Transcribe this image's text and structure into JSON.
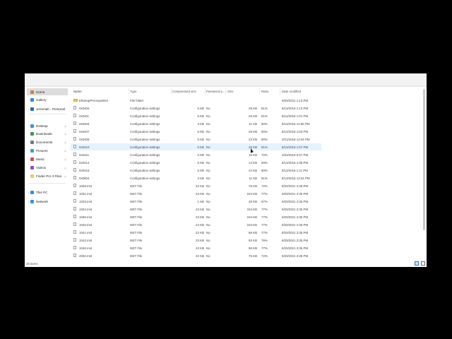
{
  "sidebar": {
    "items": [
      {
        "label": "Home",
        "icon": "home-icon",
        "color": "#e07b39"
      },
      {
        "label": "Gallery",
        "icon": "gallery-icon",
        "color": "#2f8ae0"
      },
      {
        "label": "Jeremiah - Personal",
        "icon": "cloud-icon",
        "color": "#1f6fc4"
      },
      {
        "label": "Desktop",
        "icon": "desktop-icon",
        "color": "#3a8ee6"
      },
      {
        "label": "Downloads",
        "icon": "download-icon",
        "color": "#3a9a4a"
      },
      {
        "label": "Documents",
        "icon": "documents-icon",
        "color": "#6b7b8c"
      },
      {
        "label": "Pictures",
        "icon": "pictures-icon",
        "color": "#3aa0d8"
      },
      {
        "label": "Music",
        "icon": "music-icon",
        "color": "#e0445b"
      },
      {
        "label": "Videos",
        "icon": "videos-icon",
        "color": "#8a4bd6"
      },
      {
        "label": "Finder Pro 3 Files",
        "icon": "folder-icon",
        "color": "#f0c75e"
      },
      {
        "label": "This PC",
        "icon": "pc-icon",
        "color": "#3a8ee6"
      },
      {
        "label": "Network",
        "icon": "network-icon",
        "color": "#3a8ee6"
      }
    ]
  },
  "columns": {
    "name": "Name",
    "type": "Type",
    "compressed": "Compressed size",
    "password": "Password p...",
    "size": "Size",
    "ratio": "Ratio",
    "date": "Date modified"
  },
  "files": [
    {
      "name": "ElSetupPrerequisites",
      "type": "File folder",
      "compressed": "",
      "password": "",
      "size": "",
      "ratio": "",
      "date": "9/20/2021 1:13 PM",
      "folder": true
    },
    {
      "name": "0x040a",
      "type": "Configuration settings",
      "compressed": "5 KB",
      "password": "No",
      "size": "25 KB",
      "ratio": "81%",
      "date": "8/12/2016 1:13 PM"
    },
    {
      "name": "0x040c",
      "type": "Configuration settings",
      "compressed": "5 KB",
      "password": "No",
      "size": "26 KB",
      "ratio": "81%",
      "date": "8/12/2016 1:01 PM"
    },
    {
      "name": "0x0404",
      "type": "Configuration settings",
      "compressed": "3 KB",
      "password": "No",
      "size": "11 KB",
      "ratio": "80%",
      "date": "8/12/2016 12:56 PM"
    },
    {
      "name": "0x0407",
      "type": "Configuration settings",
      "compressed": "6 KB",
      "password": "No",
      "size": "26 KB",
      "ratio": "80%",
      "date": "8/12/2016 1:03 PM"
    },
    {
      "name": "0x0409",
      "type": "Configuration settings",
      "compressed": "5 KB",
      "password": "No",
      "size": "22 KB",
      "ratio": "80%",
      "date": "3/21/2016 12:04 PM"
    },
    {
      "name": "0x0410",
      "type": "Configuration settings",
      "compressed": "5 KB",
      "password": "No",
      "size": "25 KB",
      "ratio": "81%",
      "date": "8/12/2016 1:07 PM"
    },
    {
      "name": "0x0411",
      "type": "Configuration settings",
      "compressed": "5 KB",
      "password": "No",
      "size": "15 KB",
      "ratio": "70%",
      "date": "3/22/2016 5:57 PM"
    },
    {
      "name": "0x0412",
      "type": "Configuration settings",
      "compressed": "5 KB",
      "password": "No",
      "size": "14 KB",
      "ratio": "65%",
      "date": "8/12/2016 1:08 PM"
    },
    {
      "name": "0x0416",
      "type": "Configuration settings",
      "compressed": "5 KB",
      "password": "No",
      "size": "24 KB",
      "ratio": "80%",
      "date": "8/12/2016 1:11 PM"
    },
    {
      "name": "0x0804",
      "type": "Configuration settings",
      "compressed": "3 KB",
      "password": "No",
      "size": "11 KB",
      "ratio": "81%",
      "date": "8/12/2016 12:54 PM"
    },
    {
      "name": "1028.mst",
      "type": "MST File",
      "compressed": "22 KB",
      "password": "No",
      "size": "76 KB",
      "ratio": "72%",
      "date": "9/20/2021 2:35 PM"
    },
    {
      "name": "1031.mst",
      "type": "MST File",
      "compressed": "23 KB",
      "password": "No",
      "size": "104 KB",
      "ratio": "77%",
      "date": "9/20/2021 2:35 PM"
    },
    {
      "name": "1033.mst",
      "type": "MST File",
      "compressed": "1 KB",
      "password": "No",
      "size": "20 KB",
      "ratio": "97%",
      "date": "9/20/2021 2:35 PM"
    },
    {
      "name": "1034.mst",
      "type": "MST File",
      "compressed": "23 KB",
      "password": "No",
      "size": "104 KB",
      "ratio": "77%",
      "date": "9/20/2021 2:35 PM"
    },
    {
      "name": "1036.mst",
      "type": "MST File",
      "compressed": "23 KB",
      "password": "No",
      "size": "104 KB",
      "ratio": "77%",
      "date": "9/20/2021 2:35 PM"
    },
    {
      "name": "1040.mst",
      "type": "MST File",
      "compressed": "24 KB",
      "password": "No",
      "size": "104 KB",
      "ratio": "77%",
      "date": "9/20/2021 2:35 PM"
    },
    {
      "name": "1041.mst",
      "type": "MST File",
      "compressed": "22 KB",
      "password": "No",
      "size": "96 KB",
      "ratio": "77%",
      "date": "9/20/2021 2:35 PM"
    },
    {
      "name": "1042.mst",
      "type": "MST File",
      "compressed": "23 KB",
      "password": "No",
      "size": "92 KB",
      "ratio": "76%",
      "date": "9/20/2021 2:35 PM"
    },
    {
      "name": "1046.mst",
      "type": "MST File",
      "compressed": "23 KB",
      "password": "No",
      "size": "96 KB",
      "ratio": "77%",
      "date": "9/20/2021 2:35 PM"
    },
    {
      "name": "2052.mst",
      "type": "MST File",
      "compressed": "22 KB",
      "password": "No",
      "size": "76 KB",
      "ratio": "72%",
      "date": "9/20/2021 2:35 PM"
    }
  ],
  "hover_row_index": 6,
  "status": {
    "item_count": "26 items"
  },
  "colors": {
    "selected": "#dcdcdc",
    "hover": "#e5f3ff",
    "accent": "#2a6fb8"
  }
}
